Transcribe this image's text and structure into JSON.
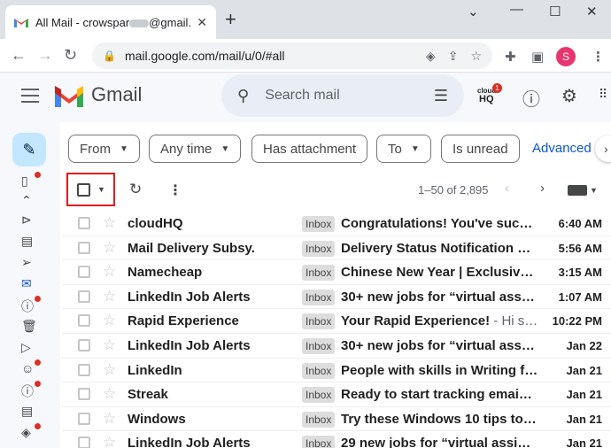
{
  "browser": {
    "tab_title": "All Mail - crowspar",
    "tab_title_tail": "@gmail.c",
    "url": "mail.google.com/mail/u/0/#all",
    "profile_initial": "S",
    "new_tab": "+"
  },
  "gmail": {
    "app_name": "Gmail",
    "search_placeholder": "Search mail",
    "cloudhq_badge": "1",
    "cloudhq_text_top": "cloud",
    "cloudhq_text_bottom": "HQ"
  },
  "filters": {
    "from": "From",
    "any_time": "Any time",
    "has_attachment": "Has attachment",
    "to": "To",
    "is_unread": "Is unread",
    "advanced": "Advanced"
  },
  "list_toolbar": {
    "pager": "1–50 of 2,895"
  },
  "emails": [
    {
      "sender": "cloudHQ",
      "label": "Inbox",
      "subject": "Congratulations! You've suc…",
      "snippet": "",
      "time": "6:40 AM"
    },
    {
      "sender": "Mail Delivery Subsy.",
      "label": "Inbox",
      "subject": "Delivery Status Notification …",
      "snippet": "",
      "time": "5:56 AM"
    },
    {
      "sender": "Namecheap",
      "label": "Inbox",
      "subject": "Chinese New Year | Exclusiv…",
      "snippet": "",
      "time": "3:15 AM"
    },
    {
      "sender": "LinkedIn Job Alerts",
      "label": "Inbox",
      "subject": "30+ new jobs for “virtual ass…",
      "snippet": "",
      "time": "1:07 AM"
    },
    {
      "sender": "Rapid Experience",
      "label": "Inbox",
      "subject": "Your Rapid Experience!",
      "snippet": " - Hi s…",
      "time": "10:22 PM"
    },
    {
      "sender": "LinkedIn Job Alerts",
      "label": "Inbox",
      "subject": "30+ new jobs for “virtual ass…",
      "snippet": "",
      "time": "Jan 22"
    },
    {
      "sender": "LinkedIn",
      "label": "Inbox",
      "subject": "People with skills in Writing f…",
      "snippet": "",
      "time": "Jan 21"
    },
    {
      "sender": "Streak",
      "label": "Inbox",
      "subject": "Ready to start tracking emai…",
      "snippet": "",
      "time": "Jan 21"
    },
    {
      "sender": "Windows",
      "label": "Inbox",
      "subject": "Try these Windows 10 tips to…",
      "snippet": "",
      "time": "Jan 21"
    },
    {
      "sender": "LinkedIn Job Alerts",
      "label": "Inbox",
      "subject": "29 new jobs for “virtual assi…",
      "snippet": "",
      "time": "Jan 21"
    }
  ],
  "colors": {
    "accent": "#0b57d0",
    "highlight": "#e11c1c",
    "compose": "#c2e7ff",
    "profile": "#e8356d"
  }
}
